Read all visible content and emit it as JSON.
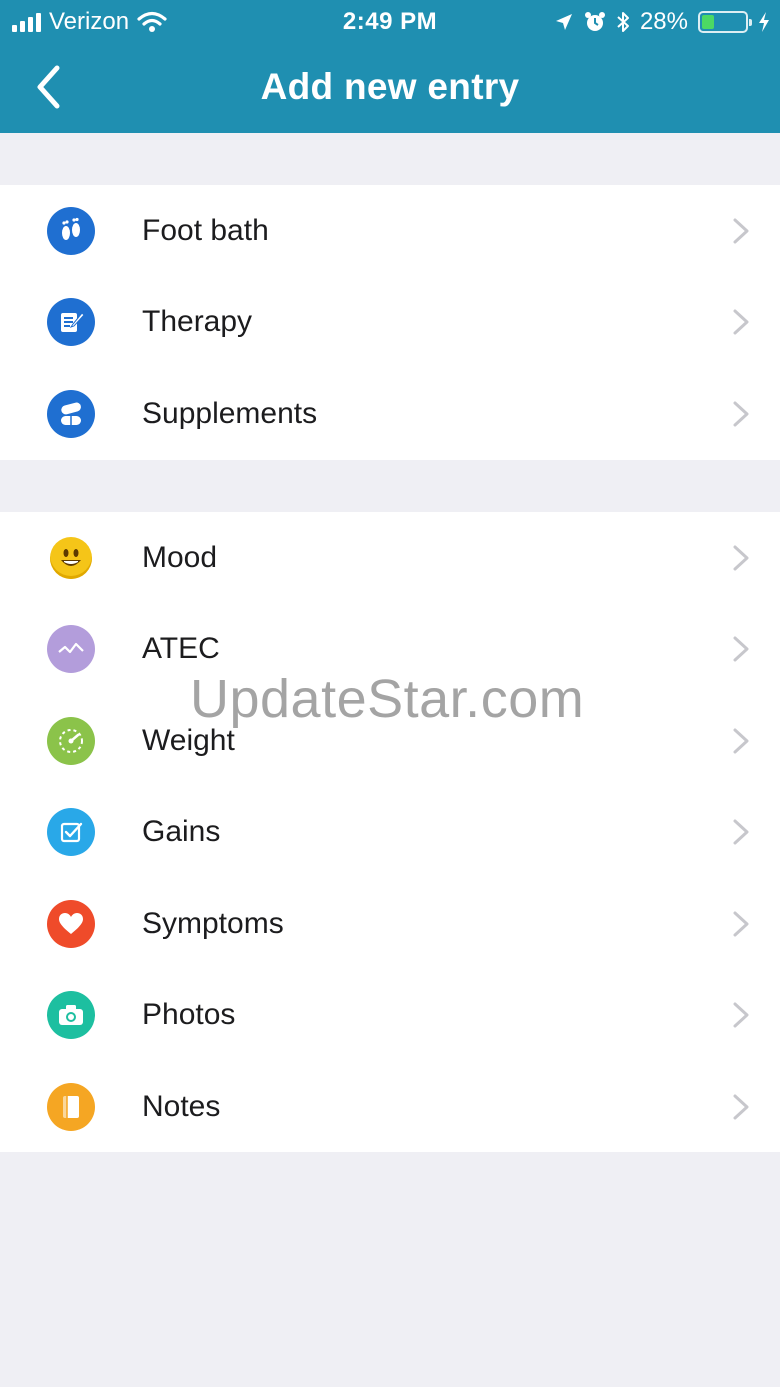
{
  "status_bar": {
    "carrier": "Verizon",
    "time": "2:49 PM",
    "battery_percent": "28%",
    "battery_level": 0.28,
    "icons": [
      "signal-icon",
      "wifi-icon",
      "location-icon",
      "alarm-icon",
      "bluetooth-icon",
      "battery-icon",
      "charging-icon"
    ]
  },
  "nav": {
    "title": "Add new entry",
    "back_icon": "chevron-left-icon"
  },
  "groups": [
    {
      "items": [
        {
          "label": "Foot bath",
          "icon": "feet-icon",
          "color": "#1f6fd1"
        },
        {
          "label": "Therapy",
          "icon": "notepad-pencil-icon",
          "color": "#1f6fd1"
        },
        {
          "label": "Supplements",
          "icon": "pills-icon",
          "color": "#1f6fd1"
        }
      ]
    },
    {
      "items": [
        {
          "label": "Mood",
          "icon": "smiley-icon",
          "color": "#f5c518"
        },
        {
          "label": "ATEC",
          "icon": "line-graph-icon",
          "color": "#b39ddb"
        },
        {
          "label": "Weight",
          "icon": "gauge-icon",
          "color": "#8bc34a"
        },
        {
          "label": "Gains",
          "icon": "checkbox-icon",
          "color": "#29a8e8"
        },
        {
          "label": "Symptoms",
          "icon": "heart-icon",
          "color": "#ef4b2a"
        },
        {
          "label": "Photos",
          "icon": "camera-icon",
          "color": "#1dbfa0"
        },
        {
          "label": "Notes",
          "icon": "notebook-icon",
          "color": "#f5a623"
        }
      ]
    }
  ],
  "watermark": "UpdateStar.com"
}
